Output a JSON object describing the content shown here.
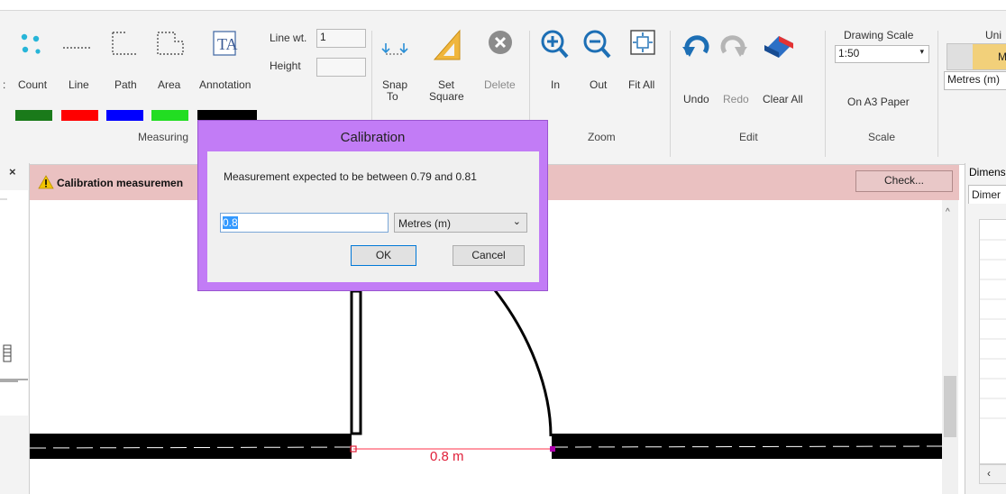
{
  "ribbon": {
    "count_label": "Count",
    "line_label": "Line",
    "path_label": "Path",
    "area_label": "Area",
    "annotation_label": "Annotation",
    "lineweight_label": "Line wt.",
    "lineweight_value": "1",
    "height_label": "Height",
    "height_value": "",
    "measuring_group": "Measuring",
    "snapto_line1": "Snap",
    "snapto_line2": "To",
    "setsquare_line1": "Set",
    "setsquare_line2": "Square",
    "delete_label": "Delete",
    "zoom_in_label": "In",
    "zoom_out_label": "Out",
    "fitall_label": "Fit All",
    "zoom_group": "Zoom",
    "undo_label": "Undo",
    "redo_label": "Redo",
    "clearall_label": "Clear All",
    "edit_group": "Edit",
    "drawing_scale_label": "Drawing Scale",
    "drawing_scale_value": "1:50",
    "paper_label": "On A3 Paper",
    "scale_group": "Scale",
    "units_label": "Uni",
    "units_toggle": "M",
    "units_value": "Metres (m)",
    "swatch_colors": [
      "#1a7a1a",
      "#ff0000",
      "#0000ff",
      "#22dd22",
      "#000000"
    ]
  },
  "banner": {
    "message": "Calibration measuremen",
    "check_label": "Check..."
  },
  "right_panel": {
    "title": "Dimens",
    "tab": "Dimer"
  },
  "dialog": {
    "title": "Calibration",
    "message": "Measurement expected to be between 0.79 and 0.81",
    "value": "0.8",
    "unit": "Metres (m)",
    "ok_label": "OK",
    "cancel_label": "Cancel"
  },
  "drawing": {
    "dimension_label": "0.8 m"
  }
}
